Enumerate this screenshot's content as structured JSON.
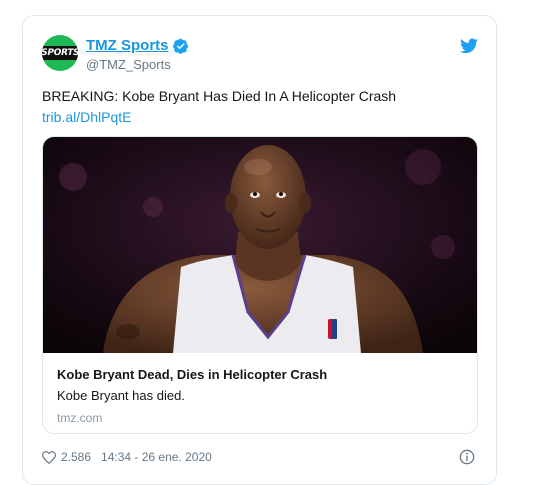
{
  "account": {
    "name": "TMZ Sports",
    "handle": "@TMZ_Sports",
    "avatar_text": "SPORTS"
  },
  "tweet": {
    "text": "BREAKING: Kobe Bryant Has Died In A Helicopter Crash",
    "link": "trib.al/DhlPqtE"
  },
  "card": {
    "title": "Kobe Bryant Dead, Dies in Helicopter Crash",
    "description": "Kobe Bryant has died.",
    "domain": "tmz.com"
  },
  "footer": {
    "likes": "2.586",
    "timestamp": "14:34 - 26 ene. 2020"
  },
  "colors": {
    "link_blue": "#1b95e0",
    "border": "#e1e8ed",
    "muted": "#657786"
  },
  "icons": [
    "verified-icon",
    "twitter-bird-icon",
    "heart-icon",
    "info-icon"
  ]
}
